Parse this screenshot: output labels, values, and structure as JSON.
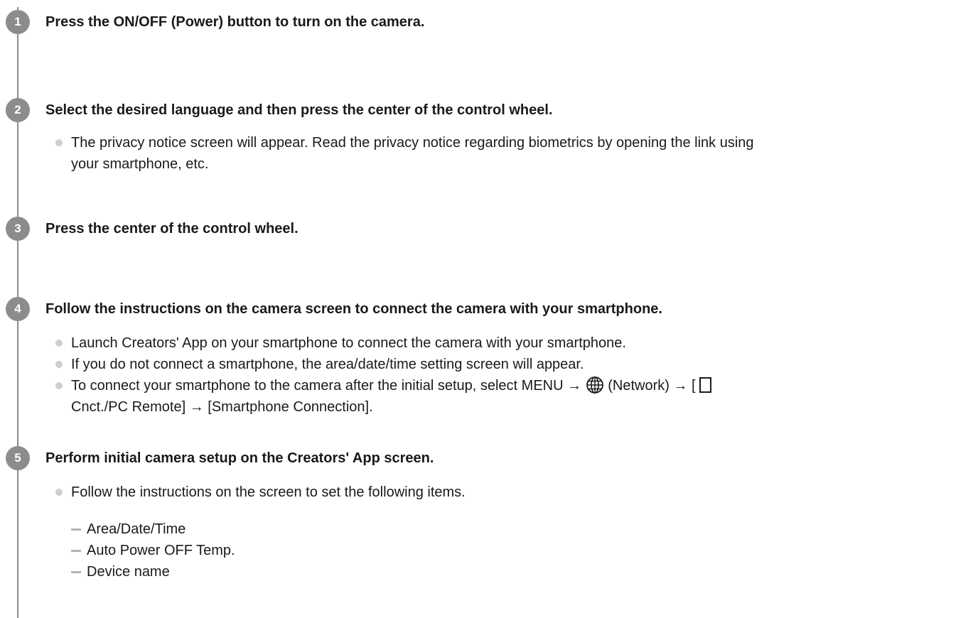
{
  "steps": [
    {
      "number": "1",
      "title": "Press the ON/OFF (Power) button to turn on the camera."
    },
    {
      "number": "2",
      "title": "Select the desired language and then press the center of the control wheel.",
      "bullets": [
        "The privacy notice screen will appear. Read the privacy notice regarding biometrics by opening the link using",
        "your smartphone, etc."
      ]
    },
    {
      "number": "3",
      "title": "Press the center of the control wheel."
    },
    {
      "number": "4",
      "title": "Follow the instructions on the camera screen to connect the camera with your smartphone.",
      "bullets": [
        "Launch Creators' App on your smartphone to connect the camera with your smartphone.",
        "If you do not connect a smartphone, the area/date/time setting screen will appear."
      ],
      "network_bullet": {
        "part1": "To connect your smartphone to the camera after the initial setup, select MENU →",
        "part2": "(Network) → [",
        "part3": "Cnct./PC Remote] → [Smartphone Connection]."
      }
    },
    {
      "number": "5",
      "title": "Perform initial camera setup on the Creators' App screen.",
      "bullets": [
        "Follow the instructions on the screen to set the following items."
      ],
      "subitems": [
        "Area/Date/Time",
        "Auto Power OFF Temp.",
        "Device name"
      ]
    }
  ],
  "icons": {
    "network": "globe-icon",
    "smartphone": "smartphone-icon",
    "bullet": "bullet-dot",
    "dash": "dash-marker"
  },
  "colors": {
    "step_badge": "#8c8c8c",
    "timeline": "#8c8c8c",
    "bullet": "#cfcfcf",
    "dash": "#b4b4b4",
    "text": "#1a1a1a"
  }
}
